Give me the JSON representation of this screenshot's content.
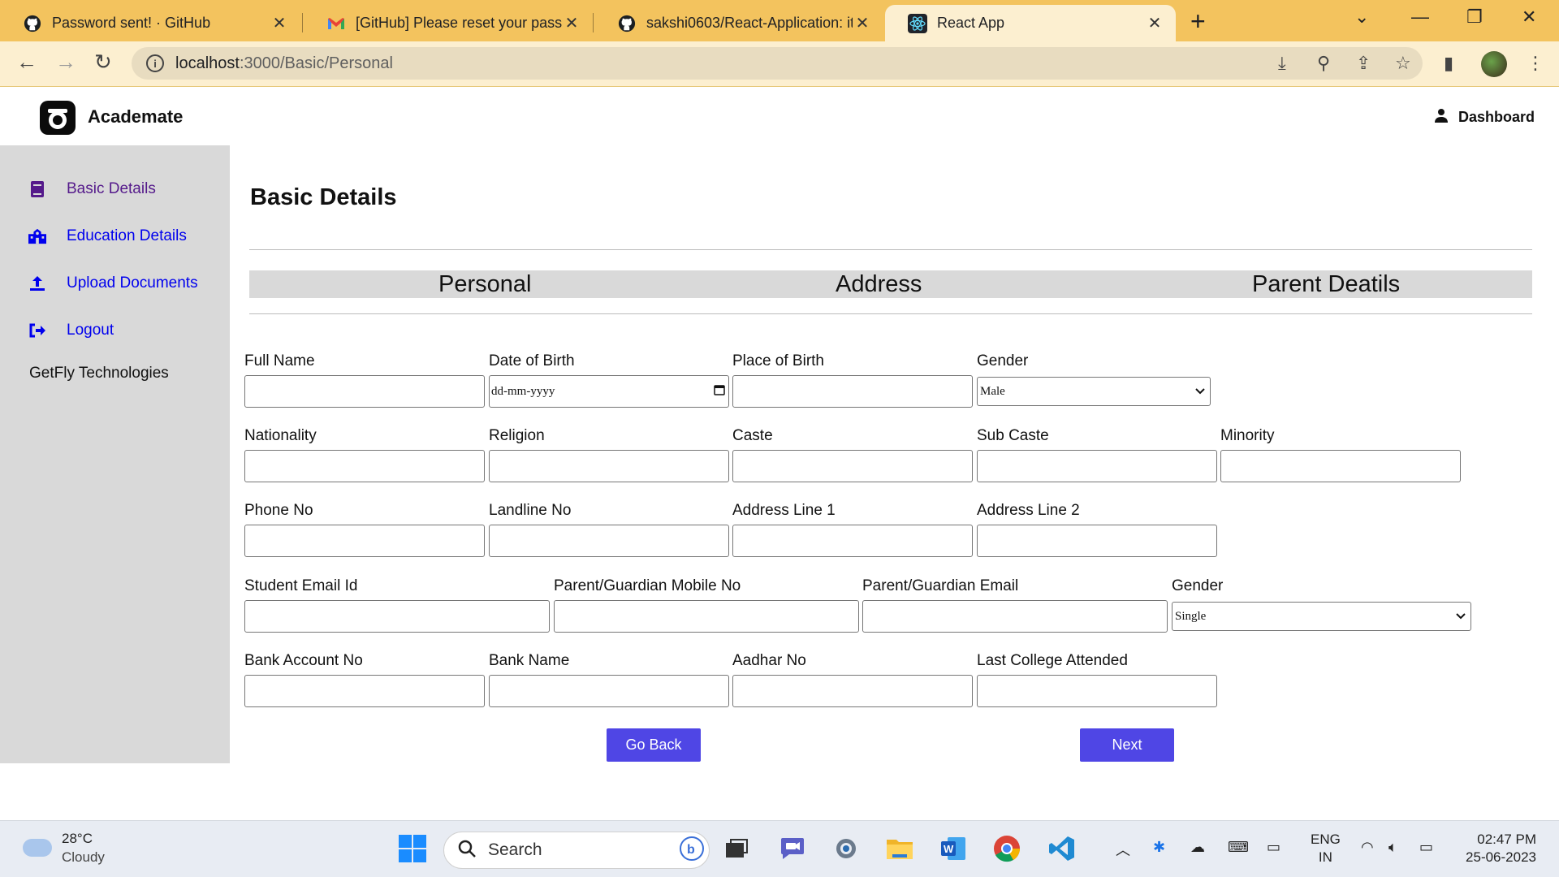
{
  "browser": {
    "tabs": [
      {
        "title": "Password sent! · GitHub",
        "icon": "github-icon",
        "active": false
      },
      {
        "title": "[GitHub] Please reset your passw",
        "icon": "gmail-icon",
        "active": false
      },
      {
        "title": "sakshi0603/React-Application: it",
        "icon": "github-icon",
        "active": false
      },
      {
        "title": "React App",
        "icon": "react-icon",
        "active": true
      }
    ],
    "url_host": "localhost",
    "url_path": ":3000/Basic/Personal"
  },
  "app": {
    "brand": "Academate",
    "dashboard_label": "Dashboard",
    "sidebar": {
      "items": [
        {
          "label": "Basic Details",
          "icon": "book-icon"
        },
        {
          "label": "Education Details",
          "icon": "school-icon"
        },
        {
          "label": "Upload Documents",
          "icon": "upload-icon"
        },
        {
          "label": "Logout",
          "icon": "logout-icon"
        }
      ],
      "company": "GetFly Technologies"
    },
    "page_title": "Basic Details",
    "subtabs": [
      "Personal",
      "Address",
      "Parent Deatils"
    ],
    "form": {
      "full_name": "Full Name",
      "dob": "Date of Birth",
      "dob_placeholder": "dd-mm-yyyy",
      "place_of_birth": "Place of Birth",
      "gender": "Gender",
      "gender_value": "Male",
      "nationality": "Nationality",
      "religion": "Religion",
      "caste": "Caste",
      "sub_caste": "Sub Caste",
      "minority": "Minority",
      "phone": "Phone No",
      "landline": "Landline No",
      "address1": "Address Line 1",
      "address2": "Address Line 2",
      "student_email": "Student Email Id",
      "parent_mobile": "Parent/Guardian Mobile No",
      "parent_email": "Parent/Guardian Email",
      "gender2": "Gender",
      "gender2_value": "Single",
      "bank_account": "Bank Account No",
      "bank_name": "Bank Name",
      "aadhar": "Aadhar No",
      "last_college": "Last College Attended"
    },
    "buttons": {
      "back": "Go Back",
      "next": "Next"
    }
  },
  "taskbar": {
    "temperature": "28°C",
    "weather": "Cloudy",
    "search_label": "Search",
    "lang_top": "ENG",
    "lang_bottom": "IN",
    "time": "02:47 PM",
    "date": "25-06-2023"
  }
}
